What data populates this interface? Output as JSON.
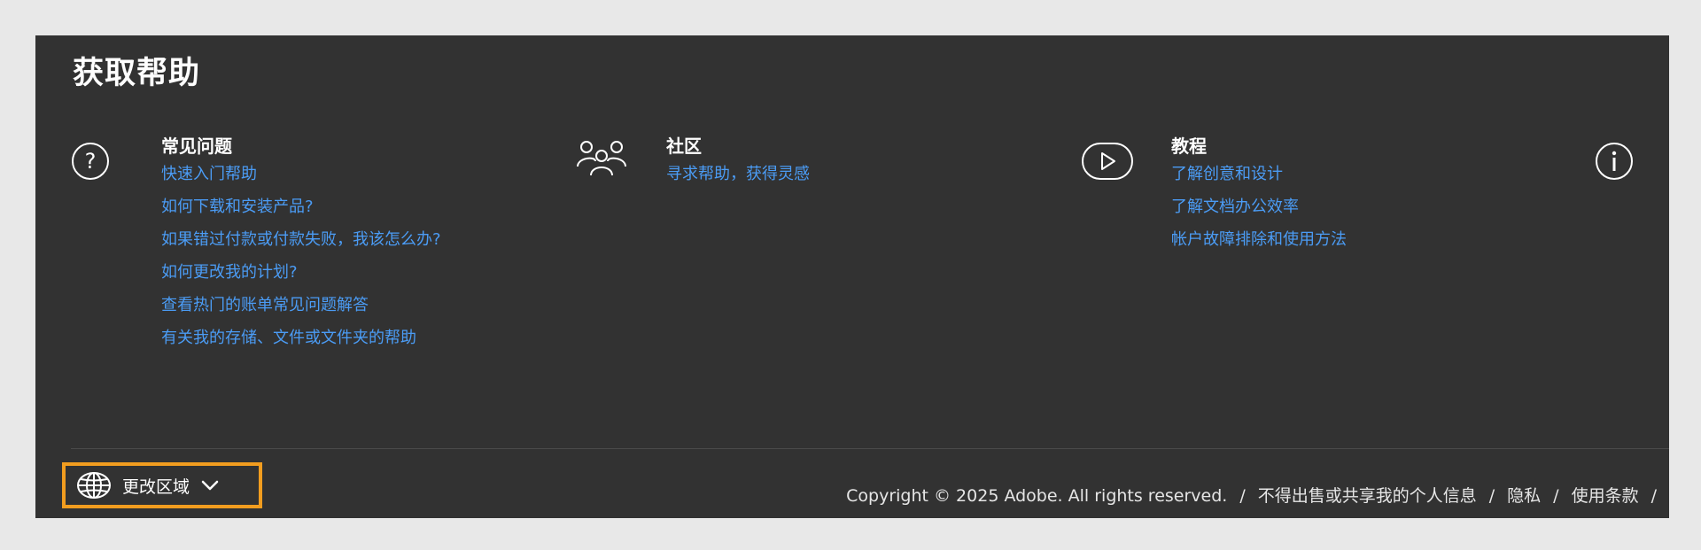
{
  "title": "获取帮助",
  "faq": {
    "heading": "常见问题",
    "links": [
      "快速入门帮助",
      "如何下载和安装产品?",
      "如果错过付款或付款失败，我该怎么办?",
      "如何更改我的计划?",
      "查看热门的账单常见问题解答",
      "有关我的存储、文件或文件夹的帮助"
    ]
  },
  "community": {
    "heading": "社区",
    "links": [
      "寻求帮助，获得灵感"
    ]
  },
  "tutorials": {
    "heading": "教程",
    "links": [
      "了解创意和设计",
      "了解文档办公效率",
      "帐户故障排除和使用方法"
    ]
  },
  "footer": {
    "region_label": "更改区域",
    "copyright": "Copyright © 2025 Adobe. All rights reserved.",
    "separator": "/",
    "do_not_sell": "不得出售或共享我的个人信息",
    "privacy": "隐私",
    "terms": "使用条款"
  },
  "colors": {
    "panel_bg": "#323232",
    "link": "#4b9cf5",
    "highlight_border": "#f29d1f"
  },
  "icons": [
    "question-icon",
    "community-icon",
    "play-icon",
    "info-icon",
    "globe-icon",
    "chevron-down-icon"
  ]
}
